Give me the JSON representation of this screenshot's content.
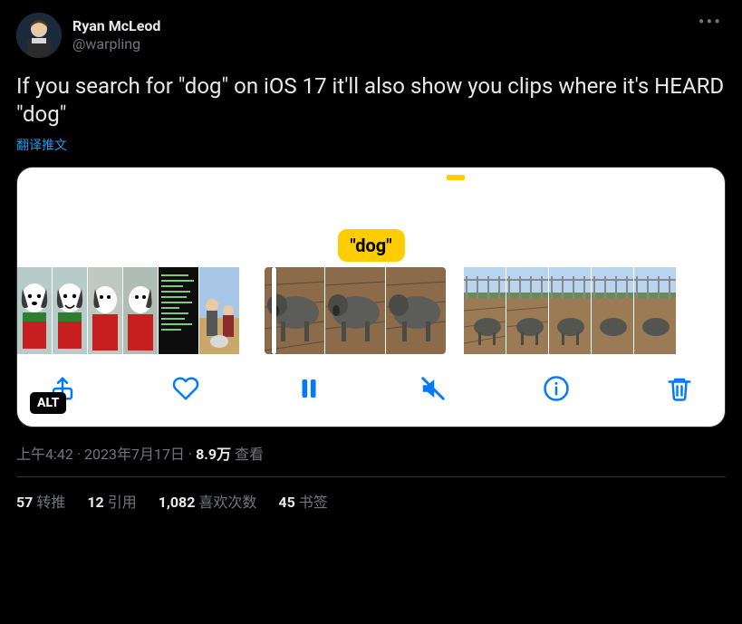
{
  "author": {
    "display_name": "Ryan McLeod",
    "handle": "@warpling"
  },
  "tweet_text": "If you search for \"dog\" on iOS 17 it'll also show you clips where it's HEARD \"dog\"",
  "translate_label": "翻译推文",
  "media": {
    "keyword_label": "\"dog\"",
    "alt_badge": "ALT"
  },
  "toolbar": {
    "share": "share",
    "like": "like",
    "pause": "pause",
    "mute": "mute",
    "info": "info",
    "delete": "delete"
  },
  "meta": {
    "time": "上午4:42",
    "date": "2023年7月17日",
    "separator": " · ",
    "views_count": "8.9万",
    "views_label": " 查看"
  },
  "stats": {
    "retweets": {
      "count": "57",
      "label": "转推"
    },
    "quotes": {
      "count": "12",
      "label": "引用"
    },
    "likes": {
      "count": "1,082",
      "label": "喜欢次数"
    },
    "bookmarks": {
      "count": "45",
      "label": "书签"
    }
  },
  "more_menu": "•••"
}
